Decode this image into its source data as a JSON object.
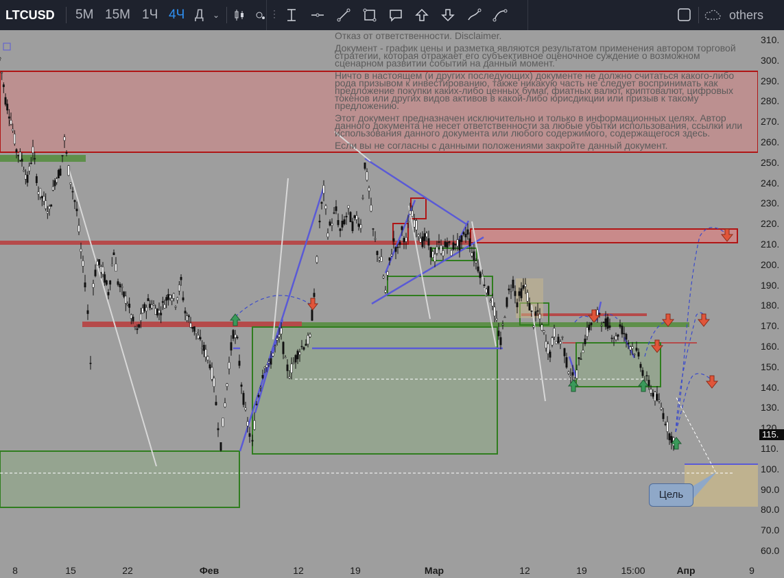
{
  "toolbar": {
    "symbol": "LTCUSD",
    "timeframes": [
      {
        "label": "5М",
        "active": false
      },
      {
        "label": "15М",
        "active": false
      },
      {
        "label": "1Ч",
        "active": false
      },
      {
        "label": "4Ч",
        "active": true
      },
      {
        "label": "Д",
        "active": false
      }
    ],
    "drawing_tools": [
      "text-cursor-icon",
      "horizontal-line-icon",
      "trend-line-icon",
      "rectangle-icon",
      "callout-icon",
      "arrow-up-icon",
      "arrow-down-icon",
      "brush-icon",
      "curve-icon"
    ],
    "others_label": "others"
  },
  "price_axis": {
    "labels": [
      "310.",
      "300.",
      "290.",
      "280.",
      "270.",
      "260.",
      "250.",
      "240.",
      "230.",
      "220.",
      "210.",
      "200.",
      "190.",
      "180.",
      "170.",
      "160.",
      "150.",
      "140.",
      "130.",
      "120.",
      "110.",
      "100.",
      "90.0",
      "80.0",
      "70.0",
      "60.0"
    ],
    "current_price": "115.",
    "current_price_value": 115
  },
  "time_axis": {
    "labels": [
      {
        "text": "8",
        "bold": false
      },
      {
        "text": "15",
        "bold": false
      },
      {
        "text": "22",
        "bold": false
      },
      {
        "text": "Фев",
        "bold": true
      },
      {
        "text": "12",
        "bold": false
      },
      {
        "text": "19",
        "bold": false
      },
      {
        "text": "Мар",
        "bold": true
      },
      {
        "text": "12",
        "bold": false
      },
      {
        "text": "19",
        "bold": false
      },
      {
        "text": "15:00",
        "bold": false
      },
      {
        "text": "Апр",
        "bold": true
      },
      {
        "text": "9",
        "bold": false
      }
    ]
  },
  "disclaimer": {
    "title": "Отказ от ответственности. Disclaimer.",
    "p1": "Документ - график цены и разметка являются результатом применения автором торговой стратегии, которая отражает его субъективное оценочное суждение о possible сценарном развитии событий на данный момент.",
    "p2": "Ничто в настоящем (и других последующих) документе не должно считаться какого-либо рода призывом к инвестированию, также никакую часть не следует воспринимать как предложение покупки каких-либо ценных бумаг, фиатных валют, криптовалют, цифровых токенов или других видов активов в какой-либо юрисдикции или призыв к такому предложению.",
    "p3": "Этот документ предназначен исключительно и только в информационных целях. Автор данного документа не несет ответственности за любые убытки использования, ссылки или использования данного документа или любого содержимого, содержащегося здесь.",
    "p4": "Если вы не согласны с данными положениями закройте данный документ."
  },
  "annotations": {
    "target_label": "Цель"
  },
  "colors": {
    "background": "#9e9e9e",
    "resistance_zone": "#c98a8a",
    "support_zone": "#5e8f4a",
    "trend_line": "#5a5ad6",
    "sell_arrow": "#e0553a",
    "buy_arrow": "#3a9a5a",
    "target_zone": "#c9b88a"
  }
}
